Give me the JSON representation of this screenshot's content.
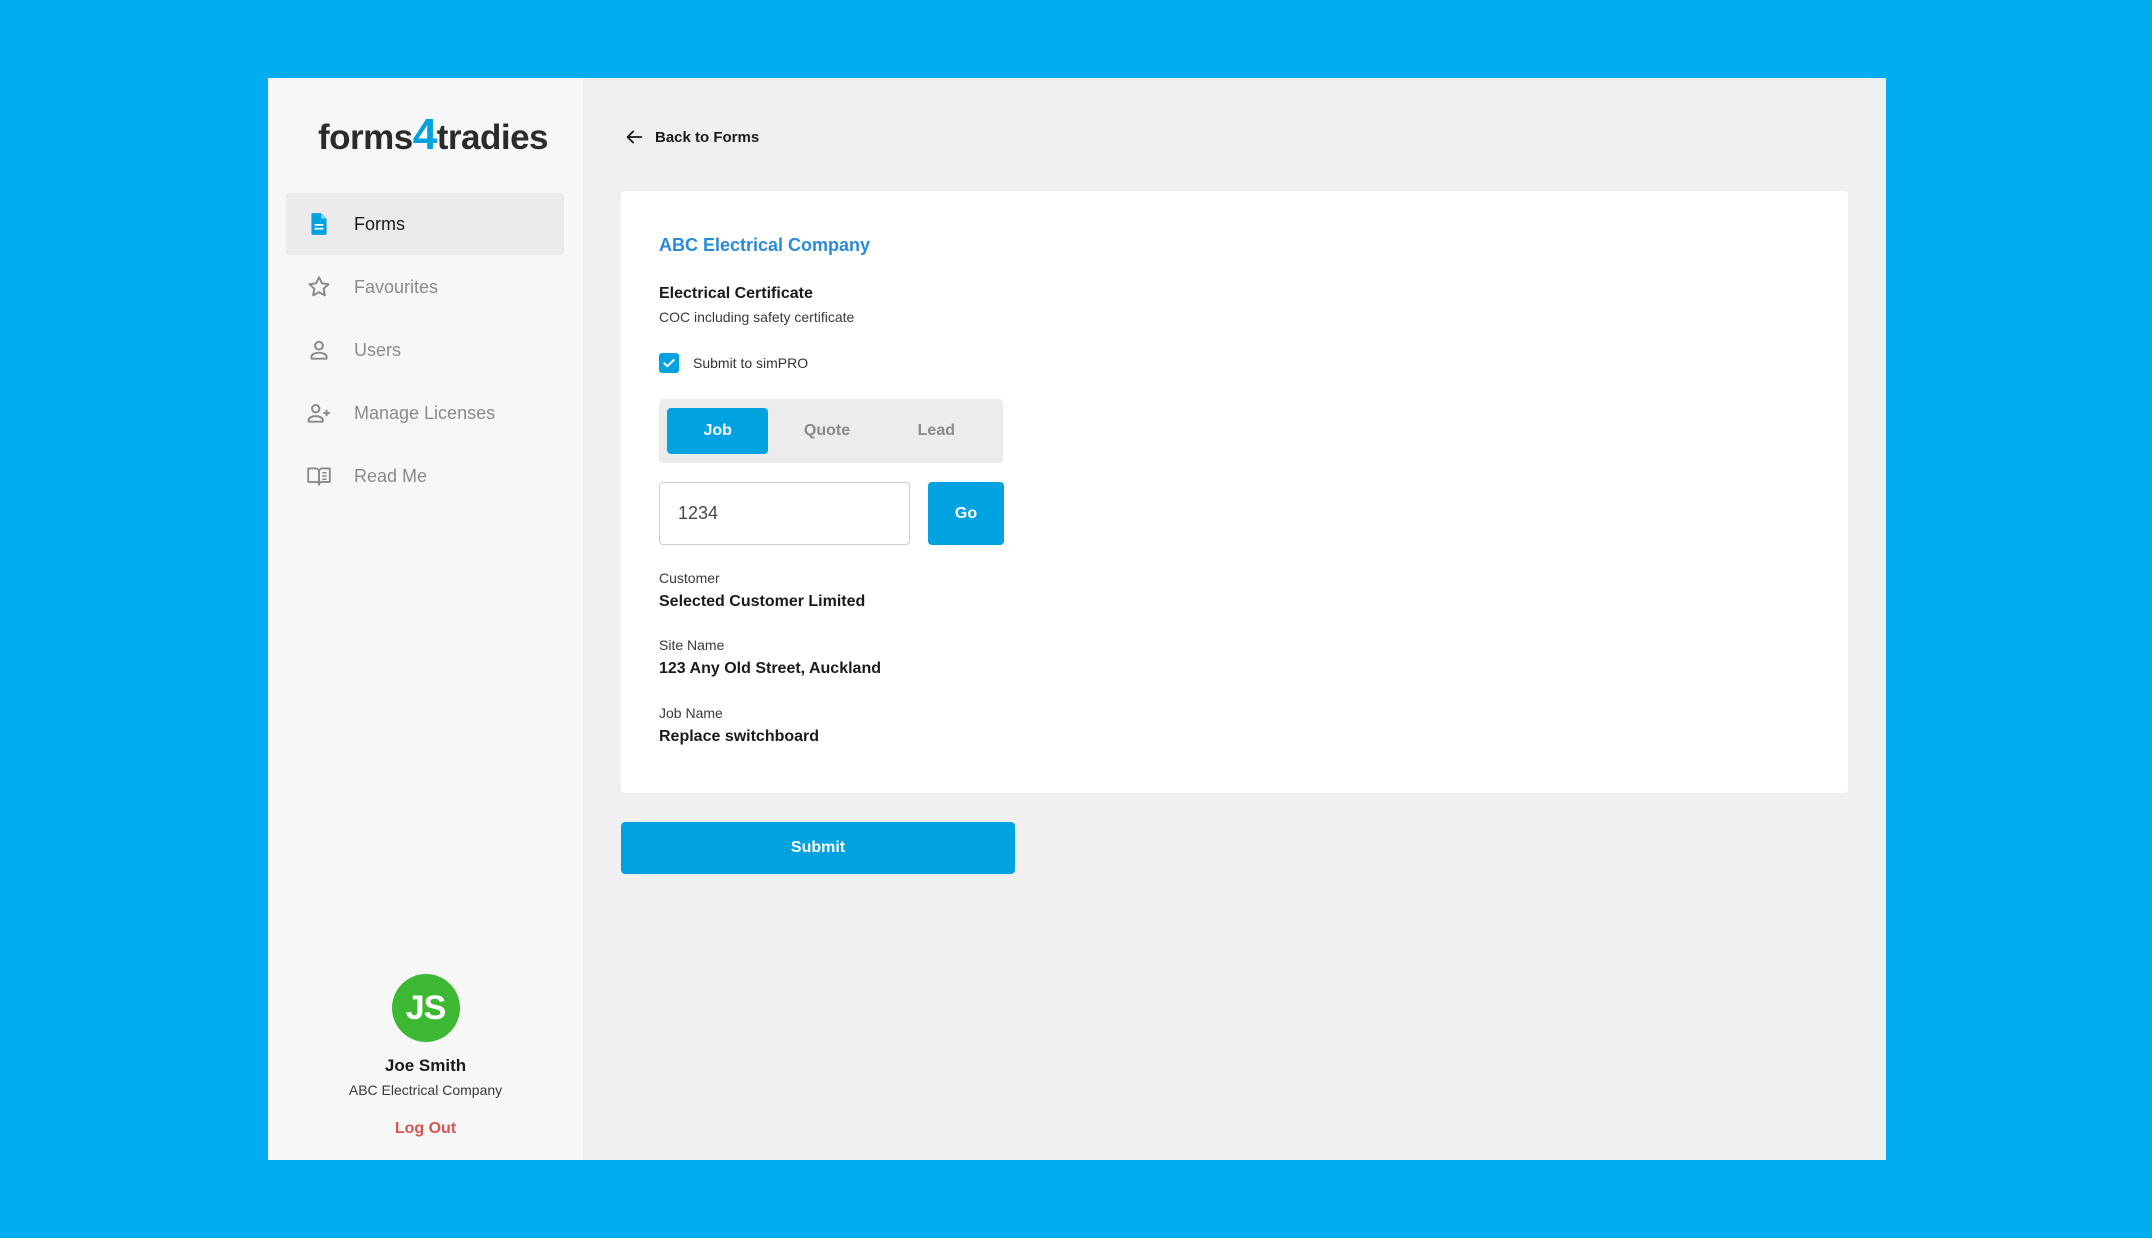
{
  "brand": {
    "name_part1": "forms",
    "name_part2": "4",
    "name_part3": "tradies"
  },
  "sidebar": {
    "items": [
      {
        "label": "Forms",
        "icon": "document-icon",
        "active": true
      },
      {
        "label": "Favourites",
        "icon": "star-icon",
        "active": false
      },
      {
        "label": "Users",
        "icon": "user-icon",
        "active": false
      },
      {
        "label": "Manage Licenses",
        "icon": "add-user-icon",
        "active": false
      },
      {
        "label": "Read Me",
        "icon": "book-icon",
        "active": false
      }
    ]
  },
  "user": {
    "initials": "JS",
    "name": "Joe Smith",
    "company": "ABC Electrical Company",
    "logout_label": "Log Out"
  },
  "main": {
    "back_label": "Back to Forms",
    "company_title": "ABC Electrical Company",
    "form_title": "Electrical Certificate",
    "form_subtitle": "COC including safety certificate",
    "checkbox_label": "Submit to simPRO",
    "checkbox_checked": true,
    "segments": [
      {
        "label": "Job",
        "active": true
      },
      {
        "label": "Quote",
        "active": false
      },
      {
        "label": "Lead",
        "active": false
      }
    ],
    "job_input_value": "1234",
    "go_label": "Go",
    "fields": [
      {
        "label": "Customer",
        "value": "Selected Customer Limited"
      },
      {
        "label": "Site Name",
        "value": "123 Any Old Street, Auckland"
      },
      {
        "label": "Job Name",
        "value": "Replace switchboard"
      }
    ],
    "submit_label": "Submit"
  },
  "colors": {
    "background": "#00aeef",
    "accent": "#00a3e0",
    "company_title": "#2a8cd8",
    "avatar": "#3db832",
    "logout": "#d9534f"
  }
}
